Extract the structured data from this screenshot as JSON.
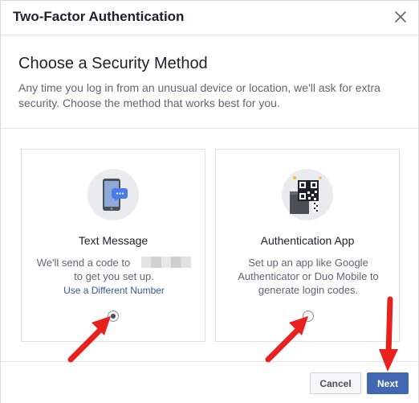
{
  "header": {
    "title": "Two-Factor Authentication",
    "close_icon": "close-icon"
  },
  "intro": {
    "title": "Choose a Security Method",
    "description": "Any time you log in from an unusual device or location, we'll ask for extra security. Choose the method that works best for you."
  },
  "options": [
    {
      "title": "Text Message",
      "description_line1": "We'll send a code to",
      "description_line2": "to get you set up.",
      "link": "Use a Different Number",
      "icon": "phone-message-icon",
      "selected": true
    },
    {
      "title": "Authentication App",
      "description": "Set up an app like Google Authenticator or Duo Mobile to generate login codes.",
      "icon": "qr-code-app-icon",
      "selected": false
    }
  ],
  "footer": {
    "cancel_label": "Cancel",
    "next_label": "Next"
  },
  "colors": {
    "primary": "#4267b2",
    "link": "#365899",
    "arrow": "#e8211e"
  }
}
